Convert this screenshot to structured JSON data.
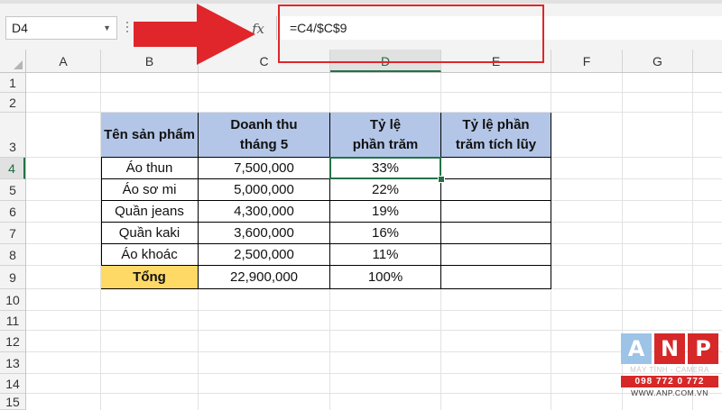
{
  "formula_bar": {
    "name_box": "D4",
    "fx_label": "fx",
    "formula": "=C4/$C$9"
  },
  "colors": {
    "header_fill": "#b4c6e7",
    "total_fill": "#ffd966",
    "selection": "#217346",
    "highlight": "#e0262a",
    "arrow": "#e0262a"
  },
  "grid": {
    "columns": [
      "A",
      "B",
      "C",
      "D",
      "E",
      "F",
      "G"
    ],
    "active_column": "D",
    "rows": [
      "1",
      "2",
      "3",
      "4",
      "5",
      "6",
      "7",
      "8",
      "9",
      "10",
      "11",
      "12",
      "13",
      "14",
      "15"
    ],
    "active_row": "4"
  },
  "table": {
    "headers": {
      "product": "Tên sản phẩm",
      "revenue_line1": "Doanh thu",
      "revenue_line2": "tháng 5",
      "pct_line1": "Tỷ lệ",
      "pct_line2": "phần trăm",
      "cum_line1": "Tỷ lệ phần",
      "cum_line2": "trăm tích lũy"
    },
    "rows": [
      {
        "product": "Áo thun",
        "revenue": "7,500,000",
        "pct": "33%",
        "cum": ""
      },
      {
        "product": "Áo sơ mi",
        "revenue": "5,000,000",
        "pct": "22%",
        "cum": ""
      },
      {
        "product": "Quần jeans",
        "revenue": "4,300,000",
        "pct": "19%",
        "cum": ""
      },
      {
        "product": "Quần kaki",
        "revenue": "3,600,000",
        "pct": "16%",
        "cum": ""
      },
      {
        "product": "Áo khoác",
        "revenue": "2,500,000",
        "pct": "11%",
        "cum": ""
      }
    ],
    "total": {
      "label": "Tổng",
      "revenue": "22,900,000",
      "pct": "100%"
    }
  },
  "logo": {
    "letters": [
      "A",
      "N",
      "P"
    ],
    "tagline": "MÁY TÍNH - CAMERA",
    "phone": "098 772 0 772",
    "website": "WWW.ANP.COM.VN"
  }
}
